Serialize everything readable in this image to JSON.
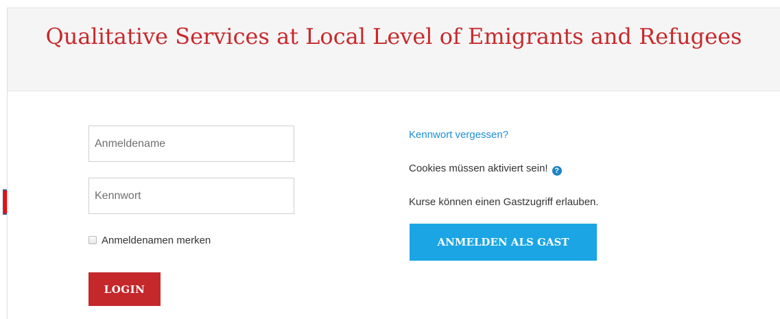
{
  "header": {
    "title": "Qualitative Services at Local Level of Emigrants and Refugees"
  },
  "login_form": {
    "username_placeholder": "Anmeldename",
    "password_placeholder": "Kennwort",
    "remember_label": "Anmeldenamen merken",
    "login_button": "LOGIN"
  },
  "guest_panel": {
    "forgot_password_link": "Kennwort vergessen?",
    "cookies_notice": "Cookies müssen aktiviert sein!",
    "guest_access_notice": "Kurse können einen Gastzugriff erlauben.",
    "guest_button": "ANMELDEN ALS GAST",
    "help_icon_glyph": "?"
  },
  "colors": {
    "brand_red": "#c4282b",
    "guest_blue": "#1ba5e4",
    "link_blue": "#1a8fd8",
    "arrow_fill": "#ff0000",
    "arrow_stroke": "#3b5c8c"
  }
}
